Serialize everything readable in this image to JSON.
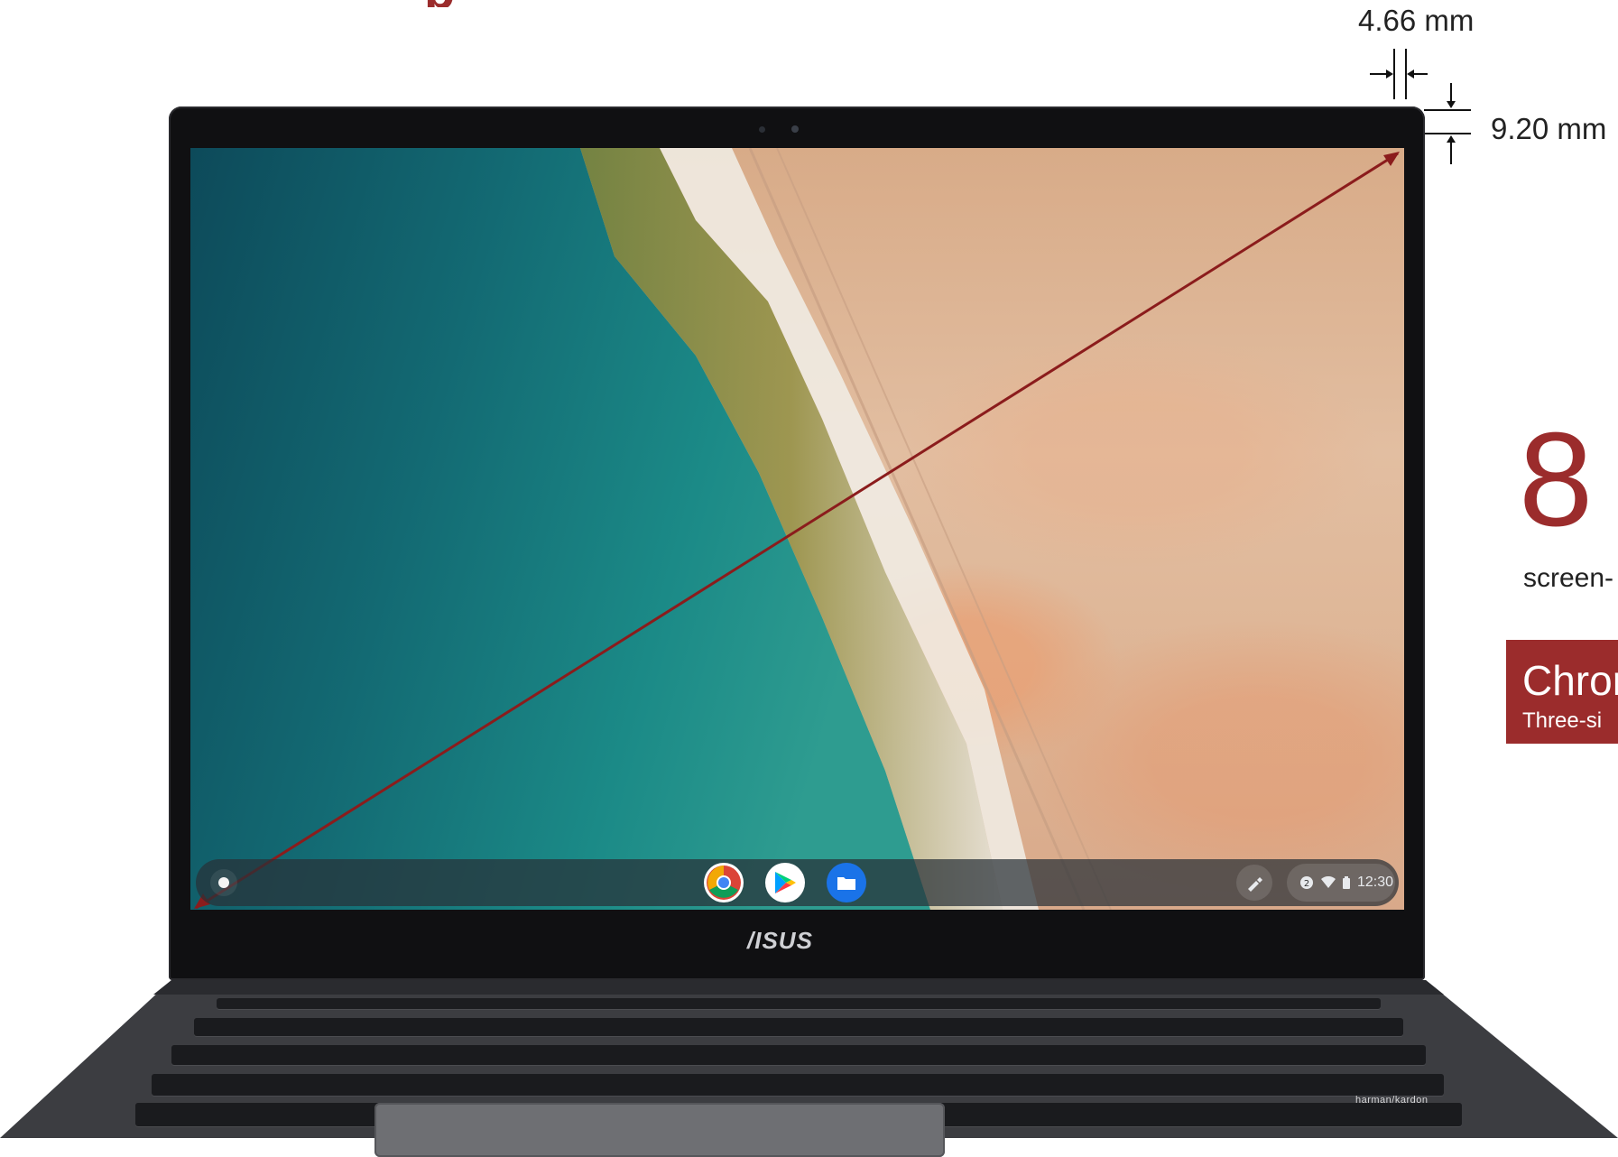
{
  "callouts": {
    "side_bezel": "4.66 mm",
    "top_bezel": "9.20 mm"
  },
  "shelf": {
    "apps": [
      {
        "name": "Chrome",
        "icon": "chrome-icon"
      },
      {
        "name": "Play Store",
        "icon": "play-store-icon"
      },
      {
        "name": "Files",
        "icon": "files-icon"
      }
    ],
    "clock": "12:30"
  },
  "brand": {
    "logo_text": "/ISUS"
  },
  "keyboard": {
    "speaker_label": "harman/kardon"
  },
  "promo": {
    "spec_number": "8",
    "spec_caption": "screen-",
    "badge_title": "Chror",
    "badge_sub": "Three-si"
  },
  "colors": {
    "accent_red": "#9b2c2c",
    "lid": "#101012"
  }
}
